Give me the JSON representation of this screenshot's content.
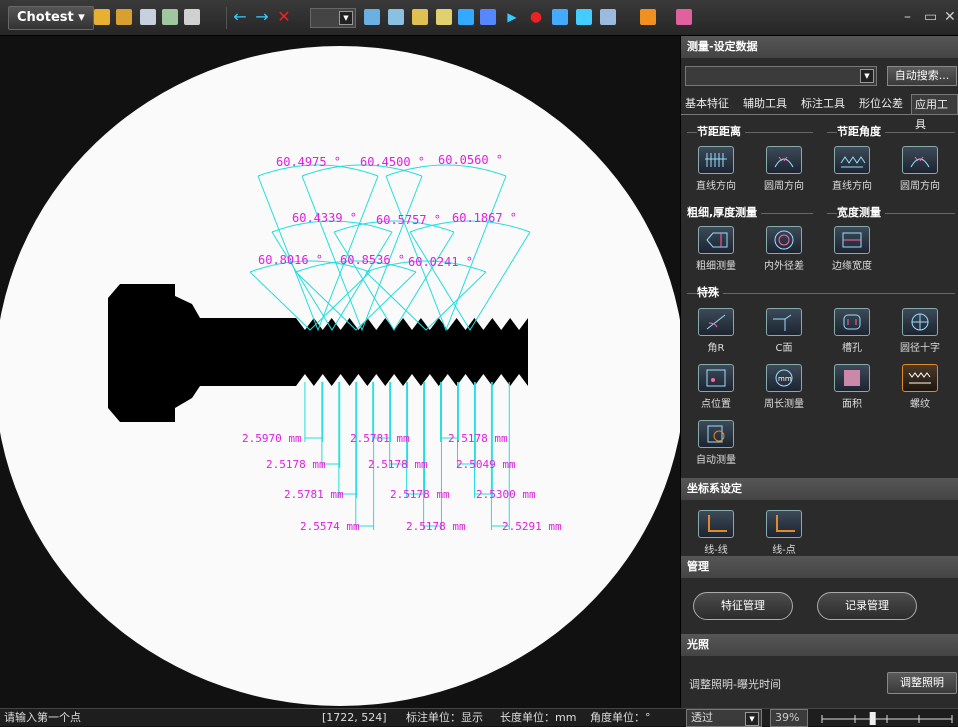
{
  "app": {
    "name": "Chotest",
    "name_arrow": "▾"
  },
  "window_controls": {
    "minimize": "–",
    "maximize": "▭",
    "close": "✕"
  },
  "panel": {
    "header": "测量-设定数据",
    "search_value": "",
    "auto_search": "自动搜索...",
    "tabs": [
      {
        "label": "基本特征",
        "active": false
      },
      {
        "label": "辅助工具",
        "active": false
      },
      {
        "label": "标注工具",
        "active": false
      },
      {
        "label": "形位公差",
        "active": false
      },
      {
        "label": "应用工具",
        "active": true
      }
    ],
    "groups": {
      "pitch_distance": "节距距离",
      "pitch_angle": "节距角度",
      "thickness": "粗细,厚度测量",
      "width": "宽度测量",
      "special": "特殊"
    },
    "tools": [
      {
        "label": "直线方向",
        "icon": "pitch-line-icon"
      },
      {
        "label": "圆周方向",
        "icon": "pitch-circle-icon"
      },
      {
        "label": "直线方向",
        "icon": "angle-line-icon"
      },
      {
        "label": "圆周方向",
        "icon": "angle-circle-icon"
      },
      {
        "label": "粗细测量",
        "icon": "thickness-icon"
      },
      {
        "label": "内外径差",
        "icon": "concentric-icon"
      },
      {
        "label": "边缘宽度",
        "icon": "edge-width-icon"
      },
      {
        "label": "角R",
        "icon": "corner-r-icon"
      },
      {
        "label": "C面",
        "icon": "chamfer-icon"
      },
      {
        "label": "槽孔",
        "icon": "slot-icon"
      },
      {
        "label": "圆径十字",
        "icon": "circle-cross-icon"
      },
      {
        "label": "点位置",
        "icon": "point-position-icon"
      },
      {
        "label": "周长测量",
        "icon": "perimeter-icon"
      },
      {
        "label": "面积",
        "icon": "area-icon"
      },
      {
        "label": "螺纹",
        "icon": "thread-icon"
      },
      {
        "label": "自动测量",
        "icon": "auto-measure-icon"
      }
    ],
    "coord_header": "坐标系设定",
    "coord_tools": [
      {
        "label": "线-线",
        "icon": "line-line-icon"
      },
      {
        "label": "线-点",
        "icon": "line-point-icon"
      }
    ],
    "manage_header": "管理",
    "feature_manage": "特征管理",
    "record_manage": "记录管理",
    "light_header": "光照",
    "light_label": "调整照明-曝光时间",
    "light_button": "调整照明"
  },
  "measurements": {
    "angles": [
      "60.4975 °",
      "60.4500 °",
      "60.0560 °",
      "60.4339 °",
      "60.5757 °",
      "60.1867 °",
      "60.8016 °",
      "60.8536 °",
      "60.0241 °"
    ],
    "pitches": [
      "2.5970 mm",
      "2.5781 mm",
      "2.5178 mm",
      "2.5178 mm",
      "2.5178 mm",
      "2.5049 mm",
      "2.5781 mm",
      "2.5178 mm",
      "2.5300 mm",
      "2.5574 mm",
      "2.5178 mm",
      "2.5291 mm"
    ]
  },
  "status": {
    "prompt": "请输入第一个点",
    "coords": "[1722, 524]",
    "label_unit": "标注单位：显示",
    "length_unit": "长度单位：mm",
    "angle_unit": "角度单位：°",
    "mode": "透过",
    "percent": "39%",
    "light_level": 0.39
  },
  "colors": {
    "annotation_text": "#e020e0",
    "annotation_line": "#22dddd",
    "accent": "#e08a2a"
  }
}
